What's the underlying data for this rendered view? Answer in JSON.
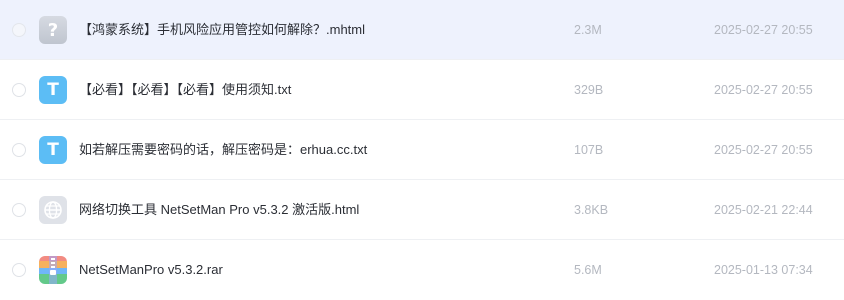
{
  "files": [
    {
      "name": "【鸿蒙系统】手机风险应用管控如何解除？.mhtml",
      "size": "2.3M",
      "date": "2025-02-27 20:55",
      "icon": "unknown-file-icon",
      "icon_glyph": "?",
      "selected": true
    },
    {
      "name": "【必看】【必看】【必看】使用须知.txt",
      "size": "329B",
      "date": "2025-02-27 20:55",
      "icon": "text-file-icon",
      "icon_glyph": "T",
      "selected": false
    },
    {
      "name": "如若解压需要密码的话，解压密码是：erhua.cc.txt",
      "size": "107B",
      "date": "2025-02-27 20:55",
      "icon": "text-file-icon",
      "icon_glyph": "T",
      "selected": false
    },
    {
      "name": "网络切换工具 NetSetMan Pro v5.3.2 激活版.html",
      "size": "3.8KB",
      "date": "2025-02-21 22:44",
      "icon": "web-file-icon",
      "selected": false
    },
    {
      "name": "NetSetManPro v5.3.2.rar",
      "size": "5.6M",
      "date": "2025-01-13 07:34",
      "icon": "archive-file-icon",
      "selected": false
    }
  ],
  "colors": {
    "selected_row_bg": "#eef2fd",
    "txt_icon": "#5cbdf5",
    "unknown_icon": "#c9ced7",
    "meta_text": "#b4b8c0"
  }
}
